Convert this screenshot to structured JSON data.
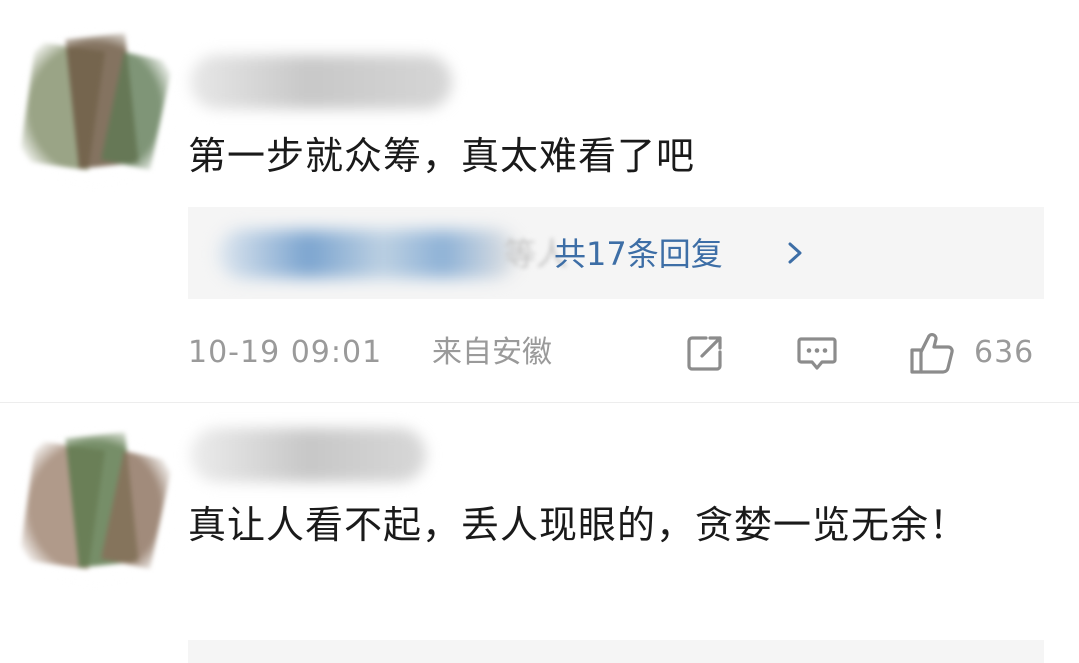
{
  "comments": [
    {
      "text": "第一步就众筹，真太难看了吧",
      "replies": {
        "name_suffix": "等人",
        "count_label": "共17条回复"
      },
      "time": "10-19 09:01",
      "location": "来自安徽",
      "likes": "636",
      "icons": {
        "share": "share-icon",
        "comment": "comment-icon",
        "like": "thumbs-up-icon",
        "chevron": "chevron-right-icon"
      }
    },
    {
      "text": "真让人看不起，丢人现眼的，贪婪一览无余！"
    }
  ],
  "colors": {
    "text": "#1a1a1a",
    "meta": "#9a9a9a",
    "link": "#3d6ea6",
    "reply_bg": "#f5f5f5"
  }
}
